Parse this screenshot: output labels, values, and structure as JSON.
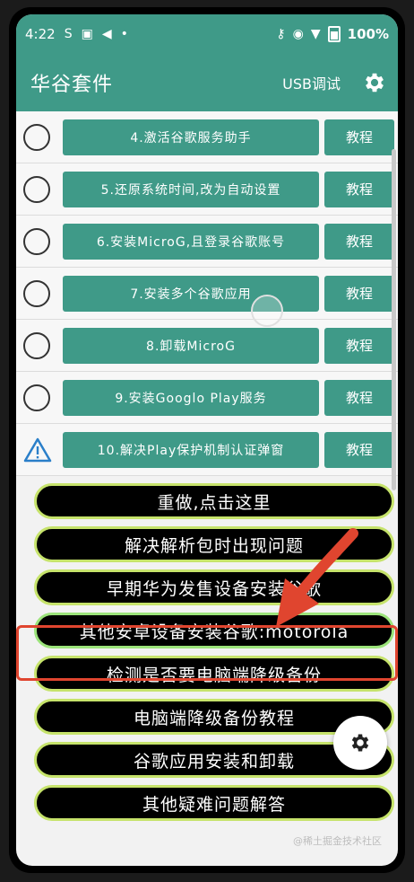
{
  "status": {
    "time": "4:22",
    "icons": [
      "sync-icon",
      "notification-icon",
      "volume-icon",
      "dot-icon"
    ],
    "right_icons": [
      "vpn-key-icon",
      "location-icon",
      "wifi-icon",
      "battery-icon"
    ],
    "battery": "100%"
  },
  "appbar": {
    "title": "华谷套件",
    "usb_label": "USB调试"
  },
  "steps": [
    {
      "label": "4.激活谷歌服务助手",
      "tutorial": "教程",
      "state": "radio"
    },
    {
      "label": "5.还原系统时间,改为自动设置",
      "tutorial": "教程",
      "state": "radio"
    },
    {
      "label": "6.安装MicroG,且登录谷歌账号",
      "tutorial": "教程",
      "state": "radio"
    },
    {
      "label": "7.安装多个谷歌应用",
      "tutorial": "教程",
      "state": "radio"
    },
    {
      "label": "8.卸载MicroG",
      "tutorial": "教程",
      "state": "radio"
    },
    {
      "label": "9.安装Googlo Play服务",
      "tutorial": "教程",
      "state": "radio"
    },
    {
      "label": "10.解决Play保护机制认证弹窗",
      "tutorial": "教程",
      "state": "warning"
    }
  ],
  "actions": [
    {
      "label": "重做,点击这里"
    },
    {
      "label": "解决解析包时出现问题"
    },
    {
      "label": "早期华为发售设备安装谷歌"
    },
    {
      "label": "其他安卓设备安装谷歌:motorola"
    },
    {
      "label": "检测是否要电脑端降级备份"
    },
    {
      "label": "电脑端降级备份教程"
    },
    {
      "label": "谷歌应用安装和卸载"
    },
    {
      "label": "其他疑难问题解答"
    }
  ],
  "watermark": "@稀土掘金技术社区",
  "colors": {
    "primary": "#3f9a88",
    "pill_bg": "#000000",
    "pill_border": "#c6e36b",
    "highlight": "#e0452f"
  }
}
